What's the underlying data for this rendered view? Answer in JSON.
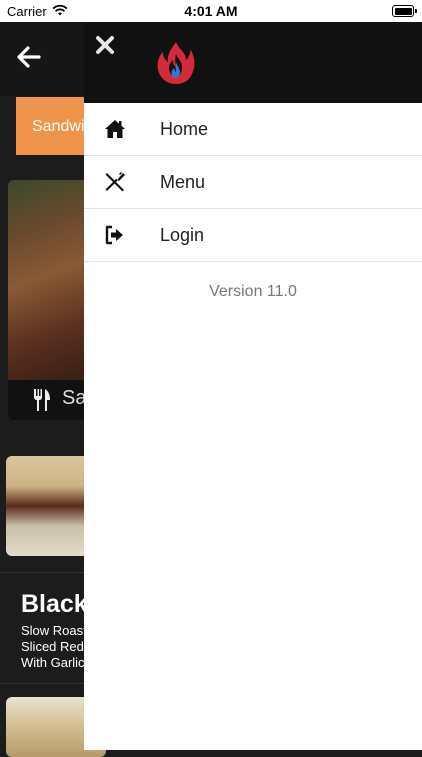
{
  "status_bar": {
    "carrier": "Carrier",
    "time": "4:01 AM"
  },
  "background": {
    "category_tab": "Sandwi",
    "card_label": "Sa",
    "item_title": "Blacke",
    "item_description": "Slow Roast Sliced Red With Garlic"
  },
  "drawer": {
    "menu_items": [
      {
        "label": "Home",
        "icon": "home-icon"
      },
      {
        "label": "Menu",
        "icon": "utensils-icon"
      },
      {
        "label": "Login",
        "icon": "login-icon"
      }
    ],
    "version": "Version 11.0"
  },
  "colors": {
    "accent": "#f0944c",
    "drawer_header": "#111111",
    "logo_flame": "#d42a3a",
    "logo_blue": "#2f7ad8"
  }
}
